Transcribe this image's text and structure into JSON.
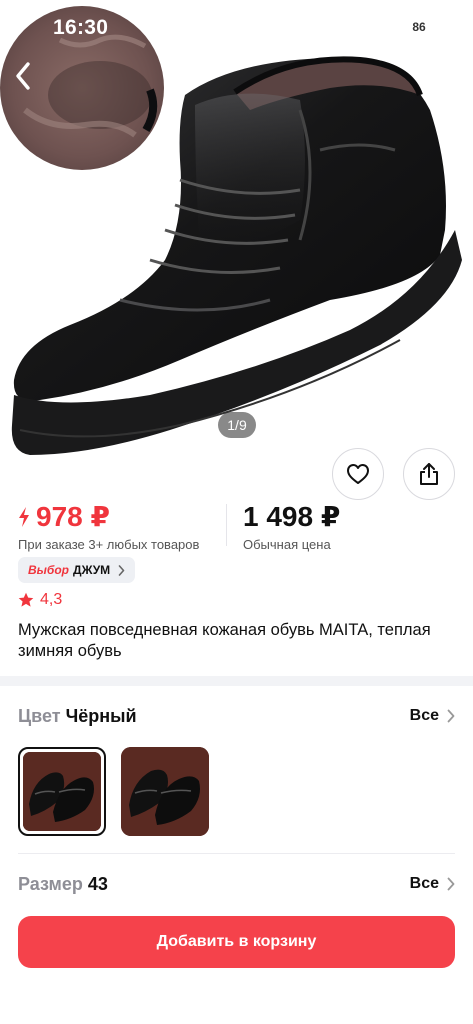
{
  "status_bar": {
    "time": "16:30",
    "battery": "86"
  },
  "gallery": {
    "counter": "1/9"
  },
  "price": {
    "discount_value": "978 ₽",
    "discount_note": "При заказе 3+ любых товаров",
    "regular_value": "1 498 ₽",
    "regular_note": "Обычная цена"
  },
  "badge": {
    "choice": "Выбор",
    "brand": "ДЖУМ"
  },
  "rating": "4,3",
  "product_title": "Мужская повседневная кожаная обувь MAITA, теплая зимняя обувь",
  "color": {
    "label": "Цвет",
    "value": "Чёрный",
    "all_label": "Все"
  },
  "size": {
    "label": "Размер",
    "value": "43",
    "all_label": "Все"
  },
  "cta_label": "Добавить в корзину",
  "colors": {
    "accent": "#f0353d",
    "cta": "#f5424b",
    "thumb_bg": "#5a2a22"
  }
}
